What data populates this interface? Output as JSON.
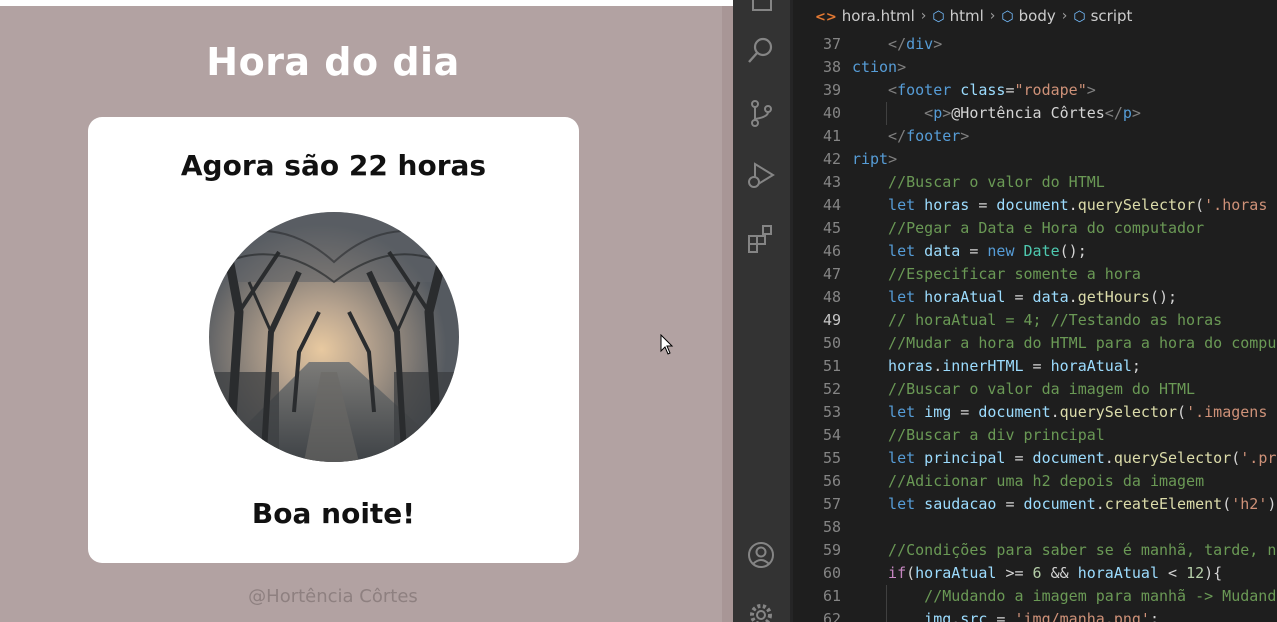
{
  "preview": {
    "page_title": "Hora do dia",
    "card_title": "Agora são 22 horas",
    "greeting": "Boa noite!",
    "footer": "@Hortência Côrtes"
  },
  "editor": {
    "breadcrumb": [
      {
        "icon": "html-file-icon",
        "label": "hora.html"
      },
      {
        "icon": "element-icon",
        "label": "html"
      },
      {
        "icon": "element-icon",
        "label": "body"
      },
      {
        "icon": "element-icon",
        "label": "script"
      }
    ],
    "active_line": 49,
    "lines": [
      {
        "num": 37,
        "indent": 1,
        "tokens": [
          [
            "t-punc",
            "</"
          ],
          [
            "t-tag",
            "div"
          ],
          [
            "t-punc",
            ">"
          ]
        ]
      },
      {
        "num": 38,
        "indent": 0,
        "tokens": [
          [
            "t-tag",
            "section"
          ],
          [
            "t-punc",
            ">"
          ]
        ],
        "clip": 2
      },
      {
        "num": 39,
        "indent": 1,
        "tokens": [
          [
            "t-punc",
            "<"
          ],
          [
            "t-tag",
            "footer"
          ],
          [
            "t-txt",
            " "
          ],
          [
            "t-attr",
            "class"
          ],
          [
            "t-txt",
            "="
          ],
          [
            "t-str",
            "\"rodape\""
          ],
          [
            "t-punc",
            ">"
          ]
        ]
      },
      {
        "num": 40,
        "indent": 2,
        "tokens": [
          [
            "t-punc",
            "<"
          ],
          [
            "t-tag",
            "p"
          ],
          [
            "t-punc",
            ">"
          ],
          [
            "t-txt",
            "@Hortência Côrtes"
          ],
          [
            "t-punc",
            "</"
          ],
          [
            "t-tag",
            "p"
          ],
          [
            "t-punc",
            ">"
          ]
        ]
      },
      {
        "num": 41,
        "indent": 1,
        "tokens": [
          [
            "t-punc",
            "</"
          ],
          [
            "t-tag",
            "footer"
          ],
          [
            "t-punc",
            ">"
          ]
        ]
      },
      {
        "num": 42,
        "indent": 0,
        "tokens": [
          [
            "t-tag",
            "script"
          ],
          [
            "t-punc",
            ">"
          ]
        ],
        "clip": 2
      },
      {
        "num": 43,
        "indent": 1,
        "tokens": [
          [
            "t-com",
            "//Buscar o valor do HTML"
          ]
        ]
      },
      {
        "num": 44,
        "indent": 1,
        "tokens": [
          [
            "t-kw",
            "let"
          ],
          [
            "t-txt",
            " "
          ],
          [
            "t-var",
            "horas"
          ],
          [
            "t-txt",
            " = "
          ],
          [
            "t-var",
            "document"
          ],
          [
            "t-txt",
            "."
          ],
          [
            "t-fn",
            "querySelector"
          ],
          [
            "t-txt",
            "("
          ],
          [
            "t-str",
            "'.horas"
          ]
        ]
      },
      {
        "num": 45,
        "indent": 1,
        "tokens": [
          [
            "t-com",
            "//Pegar a Data e Hora do computador"
          ]
        ]
      },
      {
        "num": 46,
        "indent": 1,
        "tokens": [
          [
            "t-kw",
            "let"
          ],
          [
            "t-txt",
            " "
          ],
          [
            "t-var",
            "data"
          ],
          [
            "t-txt",
            " = "
          ],
          [
            "t-kw",
            "new"
          ],
          [
            "t-txt",
            " "
          ],
          [
            "t-cls",
            "Date"
          ],
          [
            "t-txt",
            "();"
          ]
        ]
      },
      {
        "num": 47,
        "indent": 1,
        "tokens": [
          [
            "t-com",
            "//Especificar somente a hora"
          ]
        ]
      },
      {
        "num": 48,
        "indent": 1,
        "tokens": [
          [
            "t-kw",
            "let"
          ],
          [
            "t-txt",
            " "
          ],
          [
            "t-var",
            "horaAtual"
          ],
          [
            "t-txt",
            " = "
          ],
          [
            "t-var",
            "data"
          ],
          [
            "t-txt",
            "."
          ],
          [
            "t-fn",
            "getHours"
          ],
          [
            "t-txt",
            "();"
          ]
        ]
      },
      {
        "num": 49,
        "indent": 1,
        "tokens": [
          [
            "t-com",
            "// horaAtual = 4; //Testando as horas"
          ]
        ]
      },
      {
        "num": 50,
        "indent": 1,
        "tokens": [
          [
            "t-com",
            "//Mudar a hora do HTML para a hora do compu"
          ]
        ]
      },
      {
        "num": 51,
        "indent": 1,
        "tokens": [
          [
            "t-var",
            "horas"
          ],
          [
            "t-txt",
            "."
          ],
          [
            "t-var",
            "innerHTML"
          ],
          [
            "t-txt",
            " = "
          ],
          [
            "t-var",
            "horaAtual"
          ],
          [
            "t-txt",
            ";"
          ]
        ]
      },
      {
        "num": 52,
        "indent": 1,
        "tokens": [
          [
            "t-com",
            "//Buscar o valor da imagem do HTML"
          ]
        ]
      },
      {
        "num": 53,
        "indent": 1,
        "tokens": [
          [
            "t-kw",
            "let"
          ],
          [
            "t-txt",
            " "
          ],
          [
            "t-var",
            "img"
          ],
          [
            "t-txt",
            " = "
          ],
          [
            "t-var",
            "document"
          ],
          [
            "t-txt",
            "."
          ],
          [
            "t-fn",
            "querySelector"
          ],
          [
            "t-txt",
            "("
          ],
          [
            "t-str",
            "'.imagens"
          ]
        ]
      },
      {
        "num": 54,
        "indent": 1,
        "tokens": [
          [
            "t-com",
            "//Buscar a div principal"
          ]
        ]
      },
      {
        "num": 55,
        "indent": 1,
        "tokens": [
          [
            "t-kw",
            "let"
          ],
          [
            "t-txt",
            " "
          ],
          [
            "t-var",
            "principal"
          ],
          [
            "t-txt",
            " = "
          ],
          [
            "t-var",
            "document"
          ],
          [
            "t-txt",
            "."
          ],
          [
            "t-fn",
            "querySelector"
          ],
          [
            "t-txt",
            "("
          ],
          [
            "t-str",
            "'.pr"
          ]
        ]
      },
      {
        "num": 56,
        "indent": 1,
        "tokens": [
          [
            "t-com",
            "//Adicionar uma h2 depois da imagem"
          ]
        ]
      },
      {
        "num": 57,
        "indent": 1,
        "tokens": [
          [
            "t-kw",
            "let"
          ],
          [
            "t-txt",
            " "
          ],
          [
            "t-var",
            "saudacao"
          ],
          [
            "t-txt",
            " = "
          ],
          [
            "t-var",
            "document"
          ],
          [
            "t-txt",
            "."
          ],
          [
            "t-fn",
            "createElement"
          ],
          [
            "t-txt",
            "("
          ],
          [
            "t-str",
            "'h2'"
          ],
          [
            "t-txt",
            ")"
          ]
        ]
      },
      {
        "num": 58,
        "indent": 1,
        "tokens": []
      },
      {
        "num": 59,
        "indent": 1,
        "tokens": [
          [
            "t-com",
            "//Condições para saber se é manhã, tarde, n"
          ]
        ]
      },
      {
        "num": 60,
        "indent": 1,
        "tokens": [
          [
            "t-ctl",
            "if"
          ],
          [
            "t-txt",
            "("
          ],
          [
            "t-var",
            "horaAtual"
          ],
          [
            "t-txt",
            " >= "
          ],
          [
            "t-num",
            "6"
          ],
          [
            "t-txt",
            " && "
          ],
          [
            "t-var",
            "horaAtual"
          ],
          [
            "t-txt",
            " < "
          ],
          [
            "t-num",
            "12"
          ],
          [
            "t-txt",
            "){"
          ]
        ]
      },
      {
        "num": 61,
        "indent": 2,
        "tokens": [
          [
            "t-com",
            "//Mudando a imagem para manhã -> Mudand"
          ]
        ]
      },
      {
        "num": 62,
        "indent": 2,
        "tokens": [
          [
            "t-var",
            "img"
          ],
          [
            "t-txt",
            "."
          ],
          [
            "t-var",
            "src"
          ],
          [
            "t-txt",
            " = "
          ],
          [
            "t-str",
            "'img/manha.png'"
          ],
          [
            "t-txt",
            ";"
          ]
        ]
      }
    ]
  },
  "colors": {
    "preview_bg": "#b2a2a2",
    "card_bg": "#ffffff",
    "editor_bg": "#1e1e1e",
    "activity_bar_bg": "#333333"
  }
}
